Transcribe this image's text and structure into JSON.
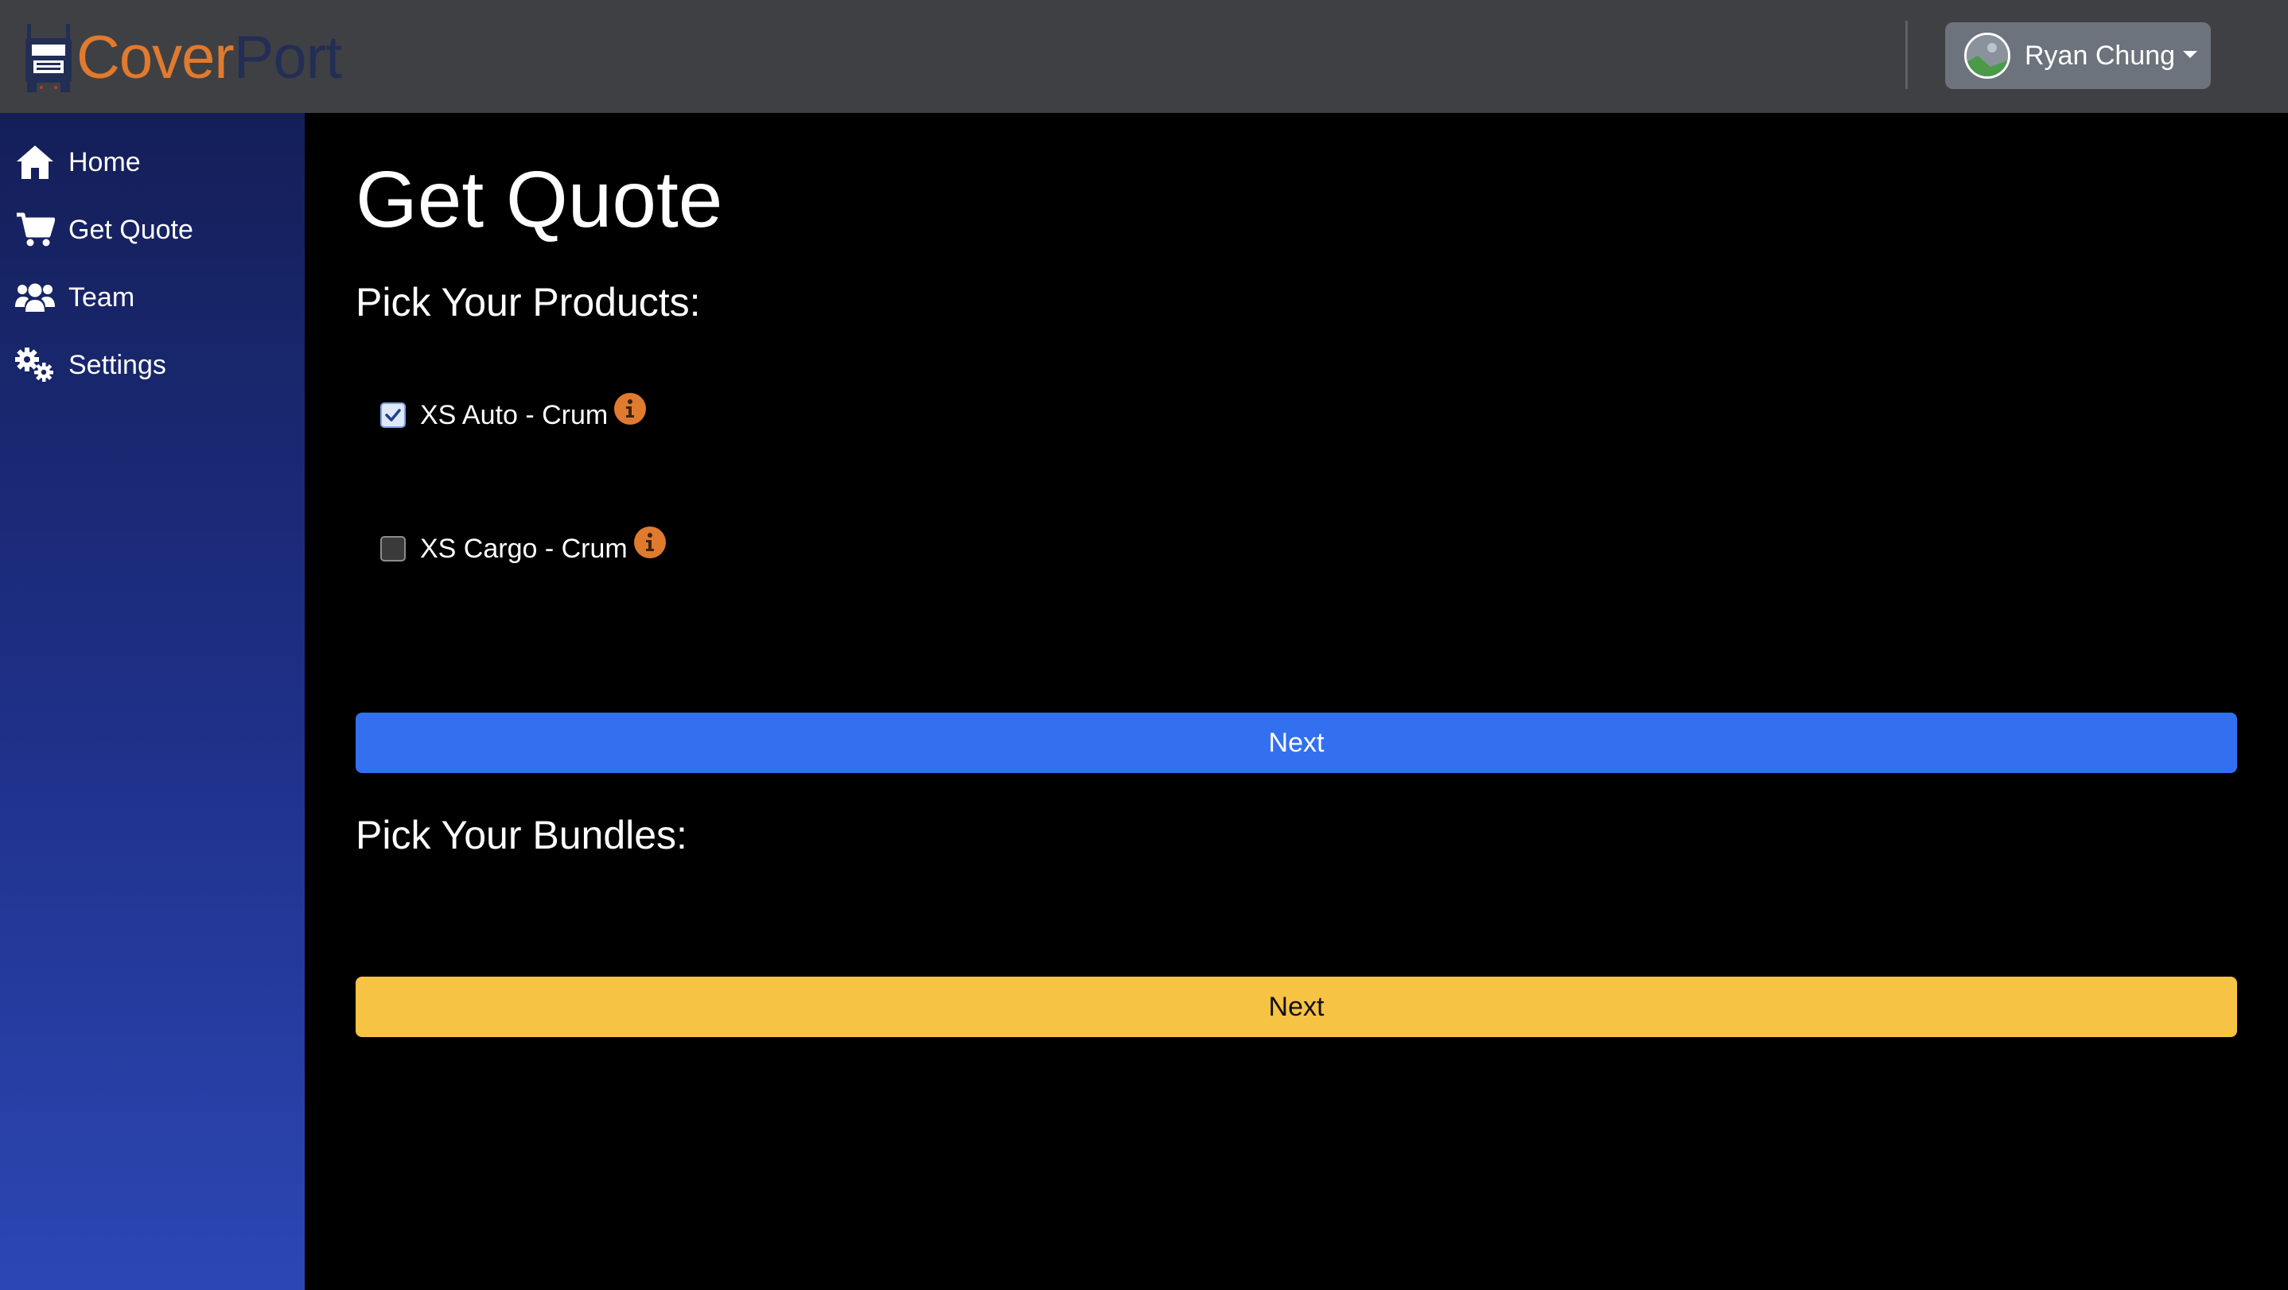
{
  "header": {
    "logo": {
      "part1": "Cover",
      "part2": "Port"
    },
    "user": {
      "name": "Ryan Chung"
    }
  },
  "sidebar": {
    "items": [
      {
        "label": "Home",
        "icon": "home-icon"
      },
      {
        "label": "Get Quote",
        "icon": "cart-icon"
      },
      {
        "label": "Team",
        "icon": "users-icon"
      },
      {
        "label": "Settings",
        "icon": "gears-icon"
      }
    ]
  },
  "main": {
    "title": "Get Quote",
    "products_heading": "Pick Your Products:",
    "products": [
      {
        "label": "XS Auto - Crum",
        "checked": true
      },
      {
        "label": "XS Cargo - Crum",
        "checked": false
      }
    ],
    "next_products": "Next",
    "bundles_heading": "Pick Your Bundles:",
    "next_bundles": "Next"
  },
  "colors": {
    "accent_orange": "#e07a2e",
    "logo_dark": "#232e55",
    "primary_blue": "#3370f0",
    "warning_yellow": "#f6c344",
    "topbar": "#3f4043",
    "user_button": "#6c737c"
  }
}
